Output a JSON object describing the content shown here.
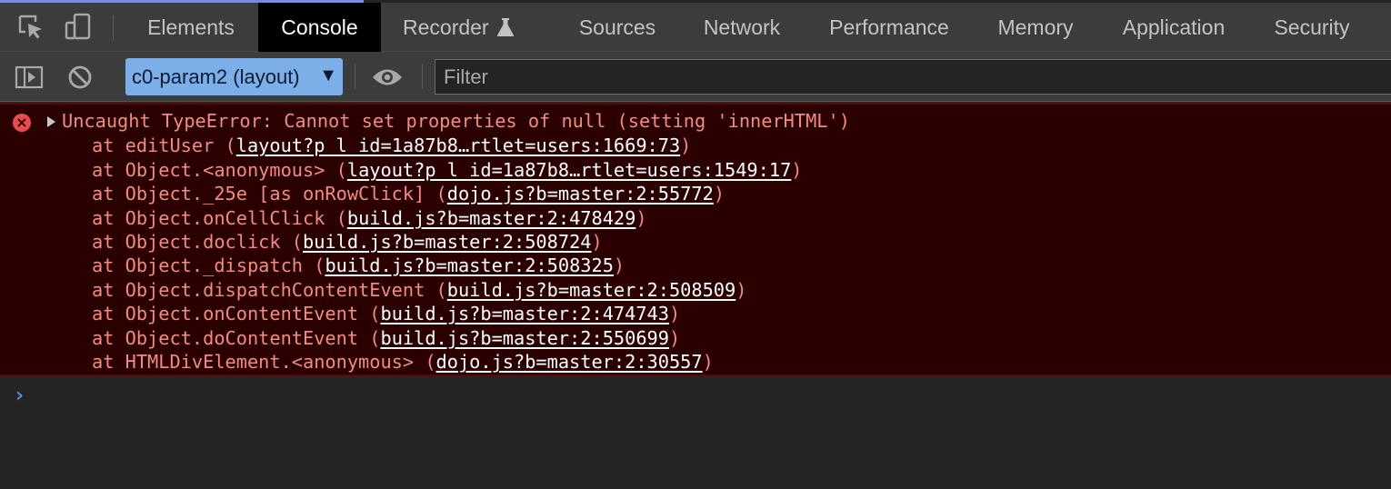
{
  "tabs": [
    {
      "label": "Elements"
    },
    {
      "label": "Console"
    },
    {
      "label": "Recorder"
    },
    {
      "label": "Sources"
    },
    {
      "label": "Network"
    },
    {
      "label": "Performance"
    },
    {
      "label": "Memory"
    },
    {
      "label": "Application"
    },
    {
      "label": "Security"
    }
  ],
  "toolbar": {
    "context": "c0-param2 (layout)",
    "filter_placeholder": "Filter"
  },
  "error": {
    "message": "Uncaught TypeError: Cannot set properties of null (setting 'innerHTML')",
    "frames": [
      {
        "fn": "at editUser ",
        "link": "layout?p_l_id=1a87b8…rtlet=users:1669:73"
      },
      {
        "fn": "at Object.<anonymous> ",
        "link": "layout?p_l_id=1a87b8…rtlet=users:1549:17"
      },
      {
        "fn": "at Object._25e [as onRowClick] ",
        "link": "dojo.js?b=master:2:55772"
      },
      {
        "fn": "at Object.onCellClick ",
        "link": "build.js?b=master:2:478429"
      },
      {
        "fn": "at Object.doclick ",
        "link": "build.js?b=master:2:508724"
      },
      {
        "fn": "at Object._dispatch ",
        "link": "build.js?b=master:2:508325"
      },
      {
        "fn": "at Object.dispatchContentEvent ",
        "link": "build.js?b=master:2:508509"
      },
      {
        "fn": "at Object.onContentEvent ",
        "link": "build.js?b=master:2:474743"
      },
      {
        "fn": "at Object.doContentEvent ",
        "link": "build.js?b=master:2:550699"
      },
      {
        "fn": "at HTMLDivElement.<anonymous> ",
        "link": "dojo.js?b=master:2:30557"
      }
    ]
  },
  "prompt": "›",
  "icons": {
    "inspect": "inspect-element-icon",
    "device": "device-toolbar-icon",
    "sidebar": "show-sidebar-icon",
    "clear": "clear-console-icon",
    "eye": "live-expression-icon",
    "flask": "flask-icon",
    "error": "error-icon"
  },
  "colors": {
    "accent": "#7caee8",
    "error_bg": "#2a0000",
    "error_text": "#f28b82",
    "prompt": "#4e8cf0"
  }
}
